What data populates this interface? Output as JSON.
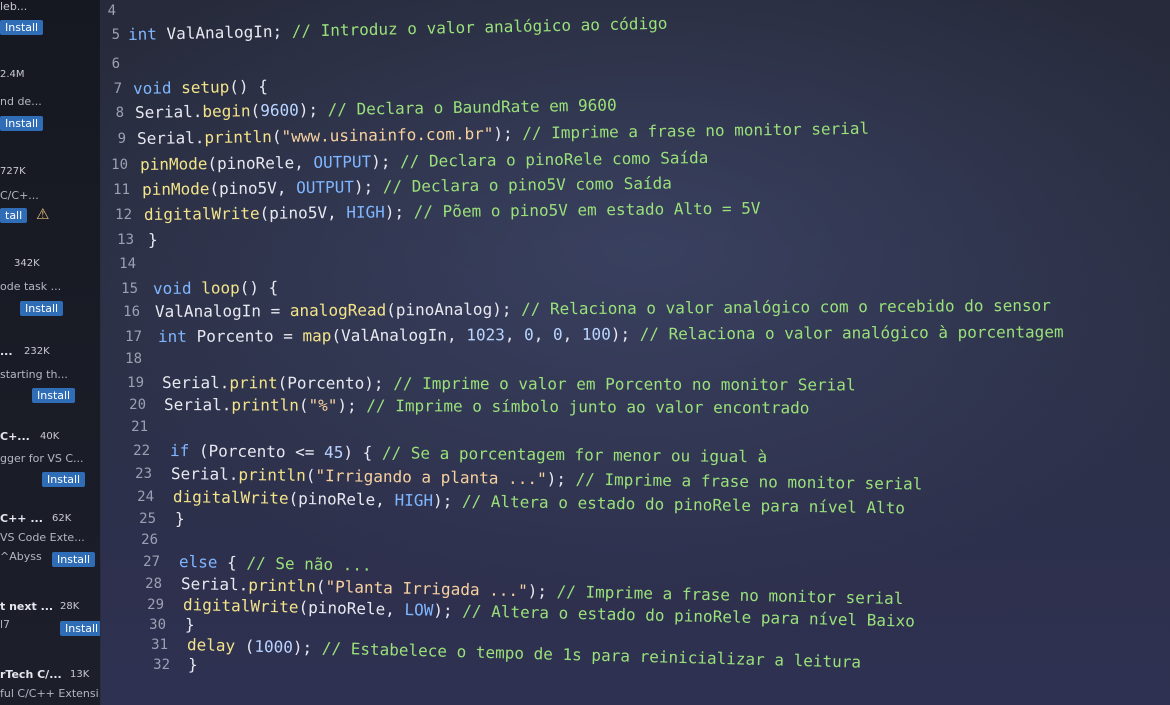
{
  "sidebar": {
    "items": [
      {
        "name": "leb...",
        "desc": "",
        "downloads": "",
        "button": "Install"
      },
      {
        "name": "",
        "desc": "nd de...",
        "downloads": "2.4M",
        "button": "Install"
      },
      {
        "name": "",
        "desc": "C/C+...",
        "downloads": "727K",
        "button": "tall"
      },
      {
        "name": "",
        "desc": "ode task ...",
        "downloads": "342K",
        "button": "Install"
      },
      {
        "name": "...",
        "desc": "starting th...",
        "downloads": "232K",
        "button": "Install"
      },
      {
        "name": "C+...",
        "desc": "gger for VS C...",
        "downloads": "40K",
        "button": "Install"
      },
      {
        "name": "C++ ...",
        "desc": "VS Code Exte...",
        "extra": "^Abyss",
        "downloads": "62K",
        "button": "Install"
      },
      {
        "name": "t next ...",
        "desc": "l7",
        "downloads": "28K",
        "button": "Install"
      },
      {
        "name": "rTech C/...",
        "desc": "ful C/C++ Extensi...",
        "downloads": "13K",
        "button": ""
      }
    ],
    "warning_icon": "warning-icon"
  },
  "editor": {
    "line_numbers": [
      "4",
      "5",
      "6",
      "7",
      "8",
      "9",
      "10",
      "11",
      "12",
      "13",
      "14",
      "15",
      "16",
      "17",
      "18",
      "19",
      "20",
      "21",
      "22",
      "23",
      "24",
      "25",
      "26",
      "27",
      "28",
      "29",
      "30",
      "31",
      "32"
    ],
    "lines": [
      "",
      "int ValAnalogIn; // Introduz o valor analógico ao código",
      "",
      "void setup() {",
      "Serial.begin(9600); // Declara o BaundRate em 9600",
      "Serial.println(\"www.usinainfo.com.br\"); // Imprime a frase no monitor serial",
      "pinMode(pinoRele, OUTPUT); // Declara o pinoRele como Saída",
      "pinMode(pino5V, OUTPUT); // Declara o pino5V como Saída",
      "digitalWrite(pino5V, HIGH); // Põem o pino5V em estado Alto = 5V",
      "}",
      "",
      "void loop() {",
      "ValAnalogIn = analogRead(pinoAnalog); // Relaciona o valor analógico com o recebido do sensor",
      "int Porcento = map(ValAnalogIn, 1023, 0, 0, 100); // Relaciona o valor analógico à porcentagem",
      "",
      "Serial.print(Porcento); // Imprime o valor em Porcento no monitor Serial",
      "Serial.println(\"%\"); // Imprime o símbolo junto ao valor encontrado",
      "",
      "if (Porcento <= 45) { // Se a porcentagem for menor ou igual à",
      "Serial.println(\"Irrigando a planta ...\"); // Imprime a frase no monitor serial",
      "digitalWrite(pinoRele, HIGH); // Altera o estado do pinoRele para nível Alto",
      "}",
      "",
      "else { // Se não ...",
      "Serial.println(\"Planta Irrigada ...\"); // Imprime a frase no monitor serial",
      "digitalWrite(pinoRele, LOW); // Altera o estado do pinoRele para nível Baixo",
      "}",
      "delay (1000); // Estabelece o tempo de 1s para reinicializar a leitura",
      "}"
    ]
  },
  "colors": {
    "keyword": "#7fb6ff",
    "function": "#f3e48a",
    "string": "#f8d1a0",
    "comment": "#9ae17a",
    "install_button": "#2f6db6"
  }
}
